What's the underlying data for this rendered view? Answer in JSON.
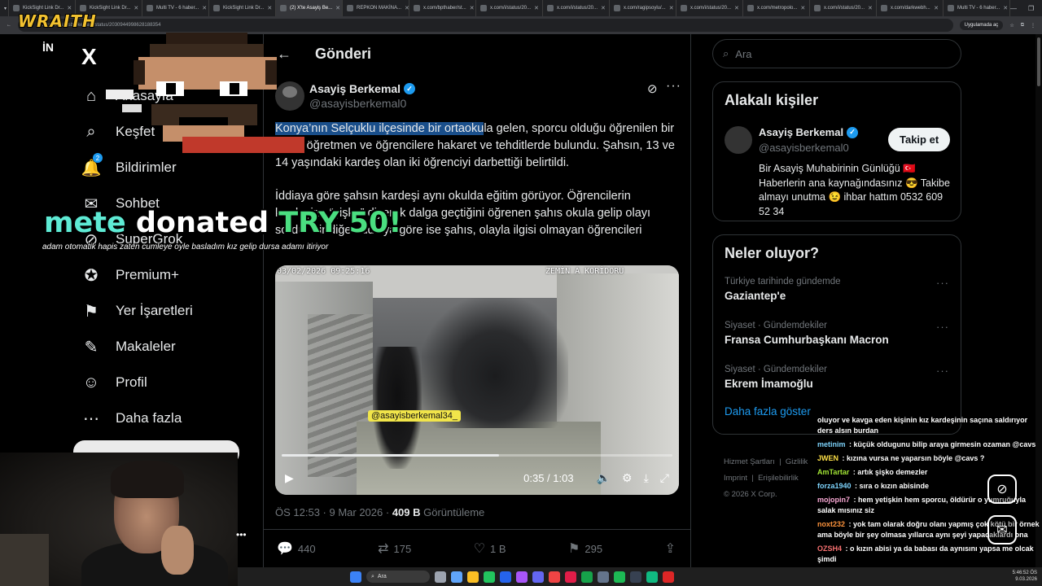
{
  "browser": {
    "tabs": [
      {
        "label": "KickSight Link Dr..."
      },
      {
        "label": "KickSight Link Dr..."
      },
      {
        "label": "Multi TV - 6 haber..."
      },
      {
        "label": "KickSight Link Dr..."
      },
      {
        "label": "(2) X'te Asayiş Be..."
      },
      {
        "label": "REPKON MAKİNA..."
      },
      {
        "label": "x.com/bpthaber/st..."
      },
      {
        "label": "x.com/i/status/20..."
      },
      {
        "label": "x.com/i/status/20..."
      },
      {
        "label": "x.com/ragipsoylu/..."
      },
      {
        "label": "x.com/i/status/20..."
      },
      {
        "label": "x.com/metropolo..."
      },
      {
        "label": "x.com/i/status/20..."
      },
      {
        "label": "x.com/darkwebh..."
      },
      {
        "label": "Multi TV - 6 haber..."
      }
    ],
    "url": "x.com/asayisberkemal0/status/2030944998628188354",
    "app_button": "Uygulamada aç"
  },
  "overlay": {
    "brand": "WRAITH",
    "in_logo": "İN",
    "donation_name": "mete",
    "donation_mid": "donated",
    "donation_amount": "TRY 50!",
    "donation_message": "adam otomatik hapis zaten cumleye oyle basladım kız gelip dursa adamı itiriyor",
    "cam_more": "•••"
  },
  "nav": {
    "logo": "X",
    "items": [
      {
        "label": "Anasayfa",
        "icon": "home-icon",
        "glyph": "⌂"
      },
      {
        "label": "Keşfet",
        "icon": "search-icon",
        "glyph": "⌕"
      },
      {
        "label": "Bildirimler",
        "icon": "bell-icon",
        "glyph": "🔔",
        "badge": "2"
      },
      {
        "label": "Sohbet",
        "icon": "mail-icon",
        "glyph": "✉"
      },
      {
        "label": "SuperGrok",
        "icon": "grok-icon",
        "glyph": "⊘"
      },
      {
        "label": "Premium+",
        "icon": "verified-icon",
        "glyph": "✪"
      },
      {
        "label": "Yer İşaretleri",
        "icon": "bookmark-icon",
        "glyph": "⚑"
      },
      {
        "label": "Makaleler",
        "icon": "article-icon",
        "glyph": "✎"
      },
      {
        "label": "Profil",
        "icon": "person-icon",
        "glyph": "☺"
      },
      {
        "label": "Daha fazla",
        "icon": "more-circle-icon",
        "glyph": "⋯"
      }
    ]
  },
  "post": {
    "header": "Gönderi",
    "author_name": "Asayiş Berkemal",
    "author_handle": "@asayisberkemal0",
    "p1_highlight": "Konya’nın Selçuklu ilçesinde bir ortaoku",
    "p1_rest": "la gelen, sporcu olduğu öğrenilen bir şahıs öğretmen ve öğrencilere hakaret ve tehditlerde bulundu. Şahsın, 13 ve 14 yaşındaki kardeş olan iki öğrenciyi darbettiği belirtildi.",
    "p2": "İddiaya göre şahsın kardeşi aynı okulda eğitim görüyor. Öğrencilerin kardeşine “şişko” diyerek dalga geçtiğini öğrenen şahıs okula gelip olayı sordu. Bir diğer iddiaya göre ise şahıs, olayla ilgisi olmayan öğrencileri",
    "video": {
      "timestamp": "03/02/2026 09:25:16",
      "location": "ZEMİN A KORİDORU",
      "watermark": "@asayisberkemal34_",
      "time": "0:35 / 1:03",
      "progress": 0.556
    },
    "meta_time": "ÖS 12:53 · 9 Mar 2026 ·",
    "views": "409 B",
    "views_label": "Görüntüleme",
    "actions": {
      "replies": "440",
      "reposts": "175",
      "likes": "1 B",
      "bookmarks": "295"
    }
  },
  "sidebar": {
    "search_placeholder": "Ara",
    "related_title": "Alakalı kişiler",
    "related": {
      "name": "Asayiş Berkemal",
      "handle": "@asayisberkemal0",
      "follow": "Takip et",
      "bio": "Bir Asayiş Muhabirinin Günlüğü 🇹🇷 Haberlerin ana kaynağındasınız 😎 Takibe almayı unutma 😉 ihbar hattım 0532 609 52 34"
    },
    "trends_title": "Neler oluyor?",
    "trends": [
      {
        "context": "Türkiye tarihinde gündemde",
        "title": "Gaziantep'e"
      },
      {
        "context": "Siyaset · Gündemdekiler",
        "title": "Fransa Cumhurbaşkanı Macron"
      },
      {
        "context": "Siyaset · Gündemdekiler",
        "title": "Ekrem İmamoğlu"
      }
    ],
    "show_more": "Daha fazla göster",
    "footer1": "Hizmet Şartları",
    "footer2": "Gizlilik",
    "footer3": "Imprint",
    "footer4": "Erişilebilirlik",
    "copyright": "© 2026 X Corp."
  },
  "chat": [
    {
      "user": "",
      "text": "oluyor ve kavga eden kişinin kız kardeşinin saçına saldırıyor ders alsın burdan",
      "color": "#ffffff"
    },
    {
      "user": "metinim",
      "text": "küçük oldugunu bilip araya girmesin ozaman @cavs",
      "color": "#7dd3fc"
    },
    {
      "user": "JWEN",
      "text": "kızına vursa ne yaparsın böyle @cavs ?",
      "color": "#fde047"
    },
    {
      "user": "AmTartar",
      "text": "artık şişko demezler",
      "color": "#a3e635"
    },
    {
      "user": "forza1940",
      "text": "sıra o kızın abisinde",
      "color": "#7dd3fc"
    },
    {
      "user": "mojopin7",
      "text": "hem yetişkin hem sporcu, öldürür o yumruğuyla salak mısınız siz",
      "color": "#f9a8d4"
    },
    {
      "user": "noxt232",
      "text": "yok tam olarak doğru olanı yapmış çok kötü bir örnek ama böyle bir şey olmasa yıllarca aynı şeyi yapacaklardı ona",
      "color": "#fb923c"
    },
    {
      "user": "OZSH4",
      "text": "o kızın abisi ya da babası da aynısını yapsa me olcak şimdi",
      "color": "#f87171"
    }
  ],
  "taskbar": {
    "search": "Ara",
    "time": "5:46:52 ÖS",
    "date": "9.03.2026"
  }
}
